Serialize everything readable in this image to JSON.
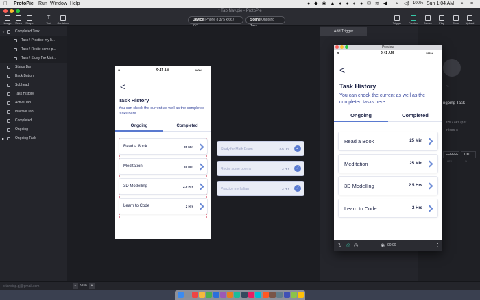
{
  "menubar": {
    "app": "ProtoPie",
    "items": [
      "Run",
      "Window",
      "Help"
    ],
    "battery": "100%",
    "clock": "Sun 1:04 AM"
  },
  "window": {
    "title": "* Tab Nav.pie - ProtoPie"
  },
  "toolbar": {
    "left_tools": [
      "Image",
      "Video",
      "Shape",
      "Text",
      "Container"
    ],
    "device_label": "Device",
    "device_value": "iPhone 8 375 x 667 @2 x",
    "scene_label": "Scene",
    "scene_value": "Ongoing Task",
    "right_tools": [
      "Trigger",
      "Preview",
      "Device",
      "Play",
      "Cloud",
      "Upload"
    ]
  },
  "layers": [
    {
      "label": "Completed Task",
      "depth": 0
    },
    {
      "label": "Task / Practice my It...",
      "depth": 1
    },
    {
      "label": "Task / Recite some p...",
      "depth": 1
    },
    {
      "label": "Task / Study For Mat...",
      "depth": 1
    },
    {
      "label": "Status Bar",
      "depth": 0
    },
    {
      "label": "Back Button",
      "depth": 0
    },
    {
      "label": "Subhead",
      "depth": 0
    },
    {
      "label": "Task History",
      "depth": 0
    },
    {
      "label": "Active Tab",
      "depth": 0
    },
    {
      "label": "Inactive Tab",
      "depth": 0
    },
    {
      "label": "Completed",
      "depth": 0
    },
    {
      "label": "Ongoing",
      "depth": 0
    },
    {
      "label": "Ongoing Task",
      "depth": 0
    }
  ],
  "footer": {
    "email": "briandisp.pj@gmail.com",
    "zoom_minus": "−",
    "zoom": "90%",
    "zoom_plus": "+"
  },
  "screen": {
    "status_time": "9:41 AM",
    "status_battery": "100%",
    "back": "<",
    "title": "Task History",
    "subtitle": "You can check the current as well as the completed tasks here.",
    "tabs": [
      "Ongoing",
      "Completed"
    ],
    "tasks": [
      {
        "name": "Read a Book",
        "duration": "25 Min"
      },
      {
        "name": "Meditation",
        "duration": "25 Min"
      },
      {
        "name": "3D Modelling",
        "duration": "2.5 Hrs"
      },
      {
        "name": "Learn to Code",
        "duration": "2 Hrs"
      }
    ]
  },
  "completed_tasks": [
    {
      "name": "Study for Math Exam",
      "duration": "2.5 Hrs"
    },
    {
      "name": "Recite some poems",
      "duration": "2 Hrs"
    },
    {
      "name": "Practice my Italian",
      "duration": "2 Hrs"
    }
  ],
  "right_panel": {
    "add_trigger": "Add Trigger"
  },
  "inspector": {
    "fit_label": "Fit",
    "scene_name": "ngoing Task",
    "size": "375 x 667 @2x",
    "device": "iPhone 8",
    "hex": "FFFFFF",
    "opacity": "100",
    "hex_label": "HEX",
    "opacity_label": "%"
  },
  "preview": {
    "title": "Preview",
    "bottom_time": "00:00"
  },
  "colors": {
    "accent": "#5a7ad0",
    "title": "#1d2346",
    "subtitle": "#3b4a9f",
    "panel": "#24252b",
    "canvas": "#1c1d22"
  }
}
